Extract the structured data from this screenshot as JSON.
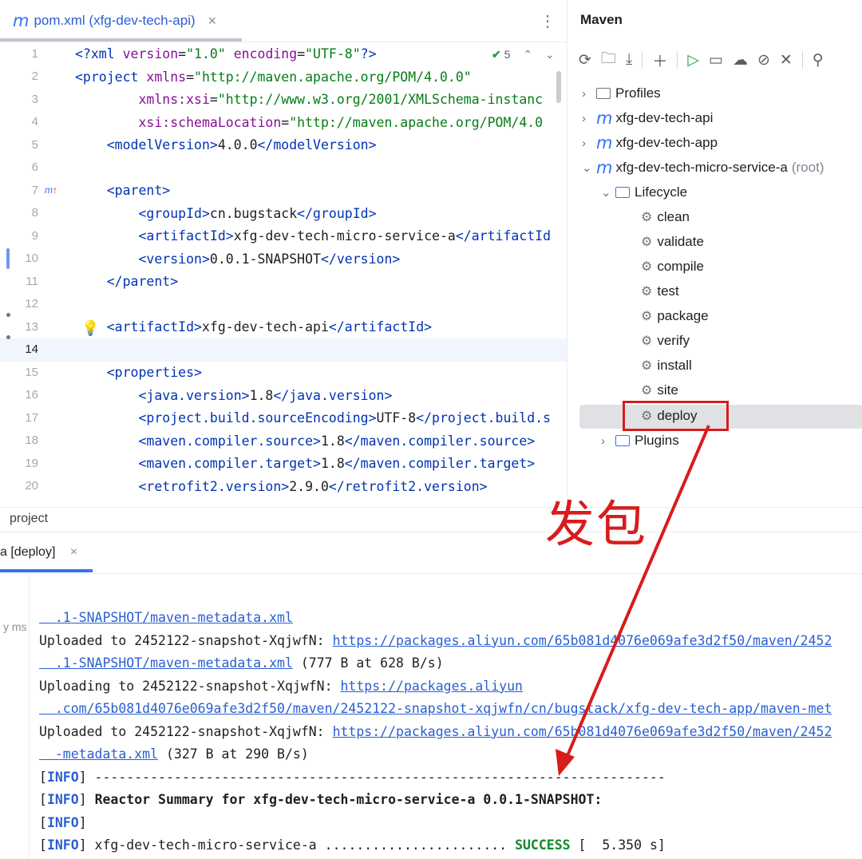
{
  "editor": {
    "tab": {
      "icon": "m",
      "title": "pom.xml (xfg-dev-tech-api)",
      "close": "×"
    },
    "more": "⋮",
    "inspections": {
      "count": "5"
    },
    "line_numbers": [
      "1",
      "2",
      "3",
      "4",
      "5",
      "6",
      "7",
      "8",
      "9",
      "10",
      "11",
      "12",
      "13",
      "14",
      "15",
      "16",
      "17",
      "18",
      "19",
      "20"
    ],
    "lines": [
      [
        [
          "tag",
          "<?xml "
        ],
        [
          "attr",
          "version"
        ],
        [
          "txt",
          "="
        ],
        [
          "val",
          "\"1.0\""
        ],
        [
          "txt",
          " "
        ],
        [
          "attr",
          "encoding"
        ],
        [
          "txt",
          "="
        ],
        [
          "val",
          "\"UTF-8\""
        ],
        [
          "tag",
          "?>"
        ]
      ],
      [
        [
          "tag",
          "<project "
        ],
        [
          "attr",
          "xmlns"
        ],
        [
          "txt",
          "="
        ],
        [
          "val",
          "\"http://maven.apache.org/POM/4.0.0\""
        ]
      ],
      [
        [
          "txt",
          "        "
        ],
        [
          "attr",
          "xmlns:xsi"
        ],
        [
          "txt",
          "="
        ],
        [
          "val",
          "\"http://www.w3.org/2001/XMLSchema-instanc"
        ]
      ],
      [
        [
          "txt",
          "        "
        ],
        [
          "attr",
          "xsi:schemaLocation"
        ],
        [
          "txt",
          "="
        ],
        [
          "val",
          "\"http://maven.apache.org/POM/4.0"
        ]
      ],
      [
        [
          "txt",
          "    "
        ],
        [
          "tag",
          "<modelVersion>"
        ],
        [
          "txt",
          "4.0.0"
        ],
        [
          "tag",
          "</modelVersion>"
        ]
      ],
      [],
      [
        [
          "txt",
          "    "
        ],
        [
          "tag",
          "<parent>"
        ]
      ],
      [
        [
          "txt",
          "        "
        ],
        [
          "tag",
          "<groupId>"
        ],
        [
          "txt",
          "cn.bugstack"
        ],
        [
          "tag",
          "</groupId>"
        ]
      ],
      [
        [
          "txt",
          "        "
        ],
        [
          "tag",
          "<artifactId>"
        ],
        [
          "txt",
          "xfg-dev-tech-micro-service-a"
        ],
        [
          "tag",
          "</artifactId"
        ]
      ],
      [
        [
          "txt",
          "        "
        ],
        [
          "tag",
          "<version>"
        ],
        [
          "txt",
          "0.0.1-SNAPSHOT"
        ],
        [
          "tag",
          "</version>"
        ]
      ],
      [
        [
          "txt",
          "    "
        ],
        [
          "tag",
          "</parent>"
        ]
      ],
      [],
      [
        [
          "txt",
          "    "
        ],
        [
          "tag",
          "<artifactId>"
        ],
        [
          "txt",
          "xfg-dev-tech-api"
        ],
        [
          "tag",
          "</artifactId>"
        ]
      ],
      [],
      [
        [
          "txt",
          "    "
        ],
        [
          "tag",
          "<properties>"
        ]
      ],
      [
        [
          "txt",
          "        "
        ],
        [
          "tag",
          "<java.version>"
        ],
        [
          "txt",
          "1.8"
        ],
        [
          "tag",
          "</java.version>"
        ]
      ],
      [
        [
          "txt",
          "        "
        ],
        [
          "tag",
          "<project.build.sourceEncoding>"
        ],
        [
          "txt",
          "UTF-8"
        ],
        [
          "tag",
          "</project.build.s"
        ]
      ],
      [
        [
          "txt",
          "        "
        ],
        [
          "tag",
          "<maven.compiler.source>"
        ],
        [
          "txt",
          "1.8"
        ],
        [
          "tag",
          "</maven.compiler.source>"
        ]
      ],
      [
        [
          "txt",
          "        "
        ],
        [
          "tag",
          "<maven.compiler.target>"
        ],
        [
          "txt",
          "1.8"
        ],
        [
          "tag",
          "</maven.compiler.target>"
        ]
      ],
      [
        [
          "txt",
          "        "
        ],
        [
          "tag",
          "<retrofit2.version>"
        ],
        [
          "txt",
          "2.9.0"
        ],
        [
          "tag",
          "</retrofit2.version>"
        ]
      ]
    ]
  },
  "maven": {
    "title": "Maven",
    "toolbar": [
      "reload-icon",
      "reload-folder-icon",
      "download-icon",
      "add-icon",
      "run-icon",
      "execute-goal-icon",
      "offline-icon",
      "skip-tests-icon",
      "collapse-icon",
      "search-icon"
    ],
    "tree": {
      "profiles": "Profiles",
      "modules": [
        "xfg-dev-tech-api",
        "xfg-dev-tech-app",
        "xfg-dev-tech-micro-service-a"
      ],
      "root_suffix": "(root)",
      "lifecycle": "Lifecycle",
      "goals": [
        "clean",
        "validate",
        "compile",
        "test",
        "package",
        "verify",
        "install",
        "site",
        "deploy"
      ],
      "plugins": "Plugins"
    },
    "selected": "deploy"
  },
  "breadcrumb": "project",
  "run": {
    "tab": "a [deploy]",
    "close": "×",
    "elapsed": "y ms",
    "lines": [
      [
        [
          "lk",
          "  .1-SNAPSHOT/maven-metadata.xml"
        ]
      ],
      [
        [
          "txt",
          "Uploaded to 2452122-snapshot-XqjwfN: "
        ],
        [
          "lk",
          "https://packages.aliyun.com/65b081d4076e069afe3d2f50/maven/2452"
        ]
      ],
      [
        [
          "lk",
          "  .1-SNAPSHOT/maven-metadata.xml"
        ],
        [
          "txt",
          " (777 B at 628 B/s)"
        ]
      ],
      [
        [
          "txt",
          "Uploading to 2452122-snapshot-XqjwfN: "
        ],
        [
          "lk",
          "https://packages.aliyun"
        ]
      ],
      [
        [
          "lk",
          "  .com/65b081d4076e069afe3d2f50/maven/2452122-snapshot-xqjwfn/cn/bugstack/xfg-dev-tech-app/maven-met"
        ]
      ],
      [
        [
          "txt",
          "Uploaded to 2452122-snapshot-XqjwfN: "
        ],
        [
          "lk",
          "https://packages.aliyun.com/65b081d4076e069afe3d2f50/maven/2452"
        ]
      ],
      [
        [
          "lk",
          "  -metadata.xml"
        ],
        [
          "txt",
          " (327 B at 290 B/s)"
        ]
      ],
      [
        [
          "txt",
          "["
        ],
        [
          "info",
          "INFO"
        ],
        [
          "txt",
          "] ------------------------------------------------------------------------"
        ]
      ],
      [
        [
          "txt",
          "["
        ],
        [
          "info",
          "INFO"
        ],
        [
          "txt",
          "] "
        ],
        [
          "bold",
          "Reactor Summary for xfg-dev-tech-micro-service-a 0.0.1-SNAPSHOT:"
        ]
      ],
      [
        [
          "txt",
          "["
        ],
        [
          "info",
          "INFO"
        ],
        [
          "txt",
          "]"
        ]
      ],
      [
        [
          "txt",
          "["
        ],
        [
          "info",
          "INFO"
        ],
        [
          "txt",
          "] xfg-dev-tech-micro-service-a ....................... "
        ],
        [
          "ok",
          "SUCCESS"
        ],
        [
          "txt",
          " [  5.350 s]"
        ]
      ]
    ]
  },
  "annotation": {
    "label": "发包",
    "color": "#d81c1c"
  }
}
